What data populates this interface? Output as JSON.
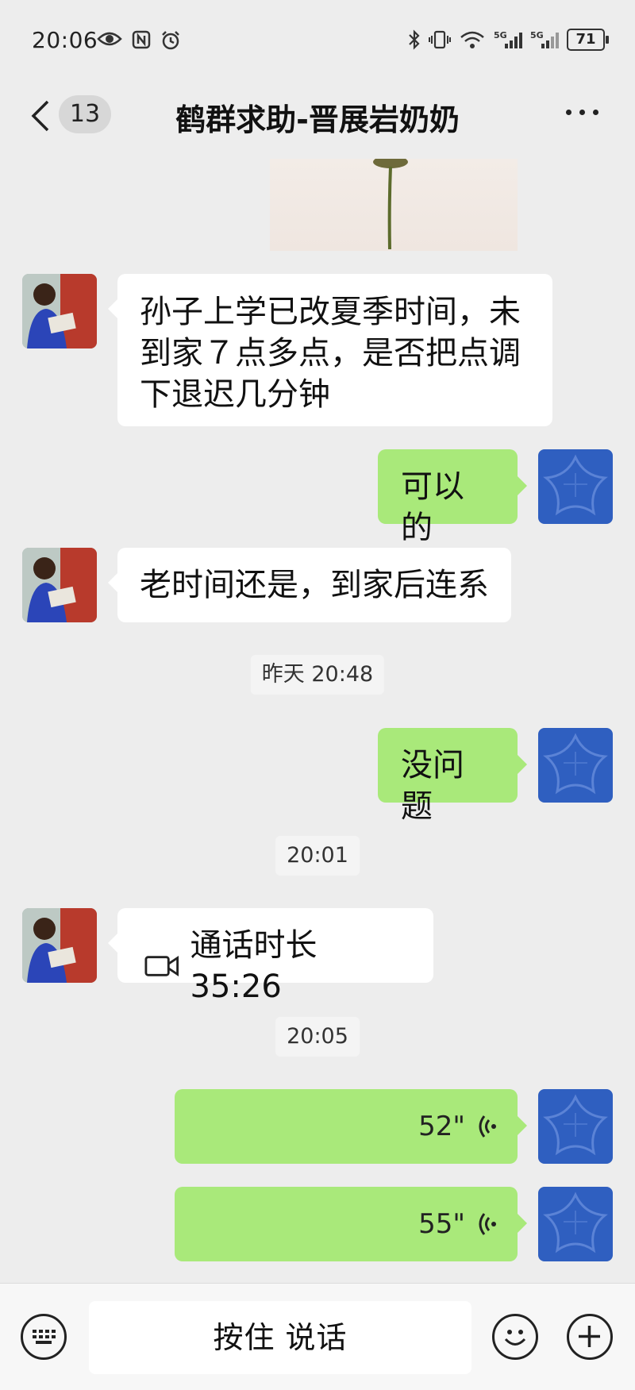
{
  "status_bar": {
    "time": "20:06",
    "battery": "71",
    "left_icons": [
      "eye-icon",
      "nfc-icon",
      "alarm-icon"
    ],
    "right_icons": [
      "bluetooth-icon",
      "vibrate-icon",
      "wifi-icon",
      "5g-signal-icon",
      "5g-signal-icon",
      "battery-icon"
    ]
  },
  "header": {
    "back_badge": "13",
    "title": "鹤群求助-晋展岩奶奶"
  },
  "messages": [
    {
      "side": "in",
      "text_line1": "孙子上学已改夏季时间，未",
      "text_line2": "到家７点多点，是否把点调",
      "text_line3": "下退迟几分钟"
    },
    {
      "side": "out",
      "text": "可以的"
    },
    {
      "side": "in",
      "text": "老时间还是，到家后连系"
    },
    {
      "type": "timestamp",
      "text": "昨天 20:48"
    },
    {
      "side": "out",
      "text": "没问题"
    },
    {
      "type": "timestamp",
      "text": "20:01"
    },
    {
      "side": "in",
      "type": "call",
      "text": "通话时长 35:26"
    },
    {
      "type": "timestamp",
      "text": "20:05"
    },
    {
      "side": "out",
      "type": "voice",
      "duration": "52\""
    },
    {
      "side": "out",
      "type": "voice",
      "duration": "55\""
    }
  ],
  "input_bar": {
    "hold_to_talk": "按住 说话"
  },
  "colors": {
    "background": "#ededed",
    "out_bubble": "#a9e97a",
    "in_bubble": "#ffffff"
  }
}
